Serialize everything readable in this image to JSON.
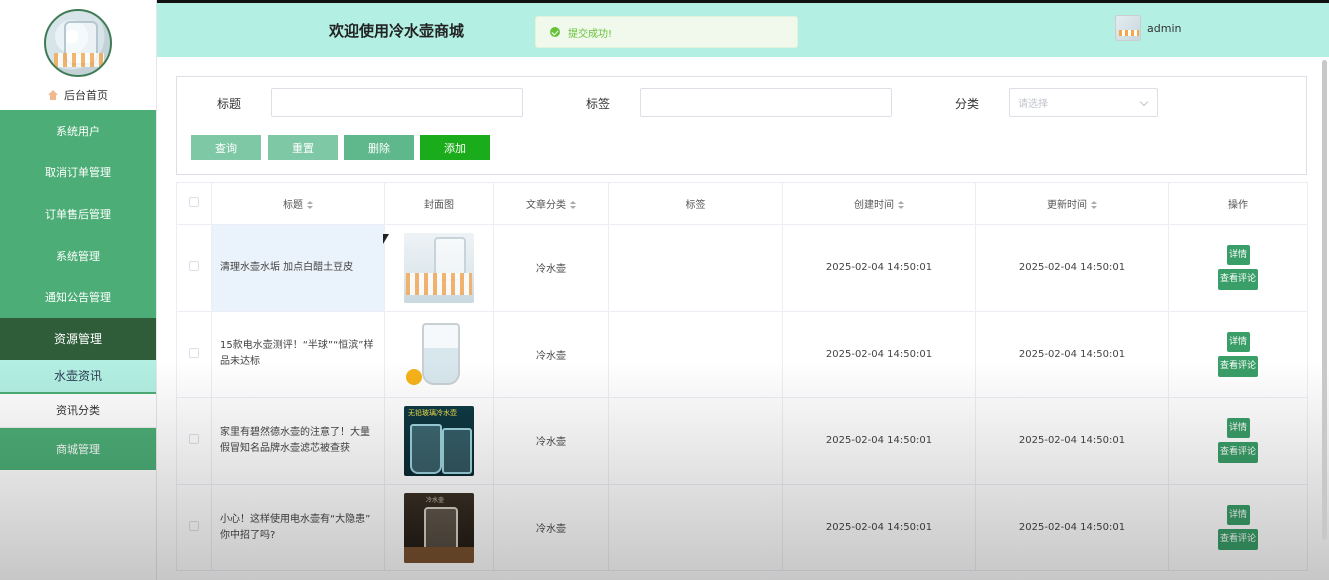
{
  "header": {
    "site_title": "欢迎使用冷水壶商城",
    "toast": "提交成功!",
    "username": "admin"
  },
  "sidebar": {
    "home_label": "后台首页",
    "items": [
      {
        "label": "系统用户"
      },
      {
        "label": "取消订单管理"
      },
      {
        "label": "订单售后管理"
      },
      {
        "label": "系统管理"
      },
      {
        "label": "通知公告管理"
      },
      {
        "label": "资源管理",
        "active": true
      }
    ],
    "subitems": [
      {
        "label": "水壶资讯",
        "active": true
      },
      {
        "label": "资讯分类"
      }
    ],
    "last_item": {
      "label": "商城管理"
    }
  },
  "search": {
    "title_label": "标题",
    "tag_label": "标签",
    "category_label": "分类",
    "category_placeholder": "请选择",
    "buttons": {
      "query": "查询",
      "reset": "重置",
      "delete": "删除",
      "add": "添加"
    }
  },
  "table": {
    "columns": {
      "title": "标题",
      "cover": "封面图",
      "category": "文章分类",
      "tag": "标签",
      "created": "创建时间",
      "updated": "更新时间",
      "actions": "操作"
    },
    "action_labels": {
      "detail": "详情",
      "comment": "查看评论"
    },
    "rows": [
      {
        "title": "清理水壶水垢 加点白醋土豆皮",
        "category": "冷水壶",
        "tag": "",
        "created": "2025-02-04 14:50:01",
        "updated": "2025-02-04 14:50:01"
      },
      {
        "title": "15款电水壶测评！“半球”“恒滨”样品未达标",
        "category": "冷水壶",
        "tag": "",
        "created": "2025-02-04 14:50:01",
        "updated": "2025-02-04 14:50:01"
      },
      {
        "title": "家里有碧然德水壶的注意了！大量假冒知名品牌水壶滤芯被查获",
        "category": "冷水壶",
        "tag": "",
        "created": "2025-02-04 14:50:01",
        "updated": "2025-02-04 14:50:01",
        "cover_text": "无铅玻璃冷水壶"
      },
      {
        "title": "小心！这样使用电水壶有“大隐患” 你中招了吗?",
        "category": "冷水壶",
        "tag": "",
        "created": "2025-02-04 14:50:01",
        "updated": "2025-02-04 14:50:01",
        "cover_text": "冷水壶"
      }
    ]
  },
  "colors": {
    "header_bg": "#b3efe3",
    "menu_green": "#4cae76",
    "menu_active": "#2f5d3a",
    "add_button": "#1aac1a",
    "success": "#67c23a"
  }
}
